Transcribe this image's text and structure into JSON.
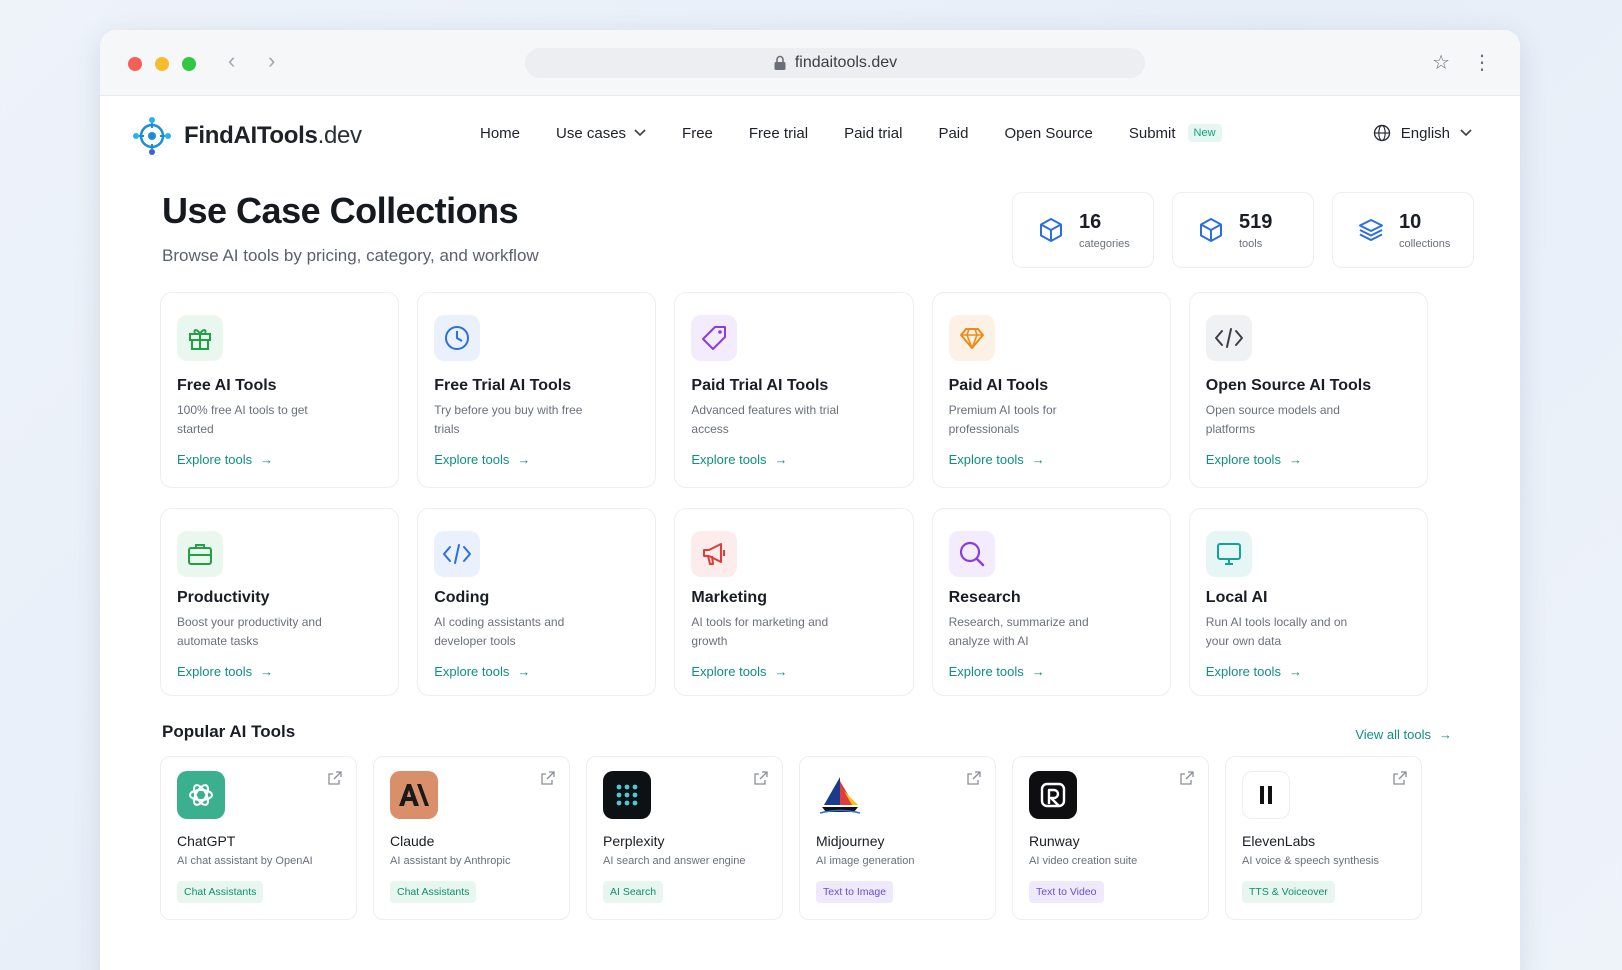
{
  "browser": {
    "url": "findaitools.dev"
  },
  "brand": {
    "name_main": "FindAITools",
    "name_suffix": ".dev"
  },
  "nav": {
    "home": "Home",
    "use_cases": "Use cases",
    "free": "Free",
    "free_trial": "Free trial",
    "paid_trial": "Paid trial",
    "paid": "Paid",
    "open_source": "Open Source",
    "submit": "Submit",
    "submit_badge": "New",
    "language": "English"
  },
  "hero": {
    "title": "Use Case Collections",
    "subtitle": "Browse AI tools by pricing, category, and workflow"
  },
  "stats": [
    {
      "value": "16",
      "label": "categories"
    },
    {
      "value": "519",
      "label": "tools"
    },
    {
      "value": "10",
      "label": "collections"
    }
  ],
  "collections_row1": [
    {
      "title": "Free AI Tools",
      "desc": "100% free AI tools to get started",
      "link": "Explore tools"
    },
    {
      "title": "Free Trial AI Tools",
      "desc": "Try before you buy with free trials",
      "link": "Explore tools"
    },
    {
      "title": "Paid Trial AI Tools",
      "desc": "Advanced features with trial access",
      "link": "Explore tools"
    },
    {
      "title": "Paid AI Tools",
      "desc": "Premium AI tools for professionals",
      "link": "Explore tools"
    },
    {
      "title": "Open Source AI Tools",
      "desc": "Open source models and platforms",
      "link": "Explore tools"
    }
  ],
  "collections_row2": [
    {
      "title": "Productivity",
      "desc": "Boost your productivity and automate tasks",
      "link": "Explore tools"
    },
    {
      "title": "Coding",
      "desc": "AI coding assistants and developer tools",
      "link": "Explore tools"
    },
    {
      "title": "Marketing",
      "desc": "AI tools for marketing and growth",
      "link": "Explore tools"
    },
    {
      "title": "Research",
      "desc": "Research, summarize and analyze with AI",
      "link": "Explore tools"
    },
    {
      "title": "Local AI",
      "desc": "Run AI tools locally and on your own data",
      "link": "Explore tools"
    }
  ],
  "popular": {
    "heading": "Popular AI Tools",
    "view_all": "View all tools",
    "tools": [
      {
        "name": "ChatGPT",
        "desc": "AI chat assistant by OpenAI",
        "tag": "Chat Assistants"
      },
      {
        "name": "Claude",
        "desc": "AI assistant by Anthropic",
        "tag": "Chat Assistants"
      },
      {
        "name": "Perplexity",
        "desc": "AI search and answer engine",
        "tag": "AI Search"
      },
      {
        "name": "Midjourney",
        "desc": "AI image generation",
        "tag": "Text to Image"
      },
      {
        "name": "Runway",
        "desc": "AI video creation suite",
        "tag": "Text to Video"
      },
      {
        "name": "ElevenLabs",
        "desc": "AI voice & speech synthesis",
        "tag": "TTS & Voiceover"
      }
    ]
  },
  "colors": {
    "accent": "#0f8f82",
    "green_tag_bg": "#e8f6f0",
    "purple_tag_bg": "#efeafb"
  }
}
